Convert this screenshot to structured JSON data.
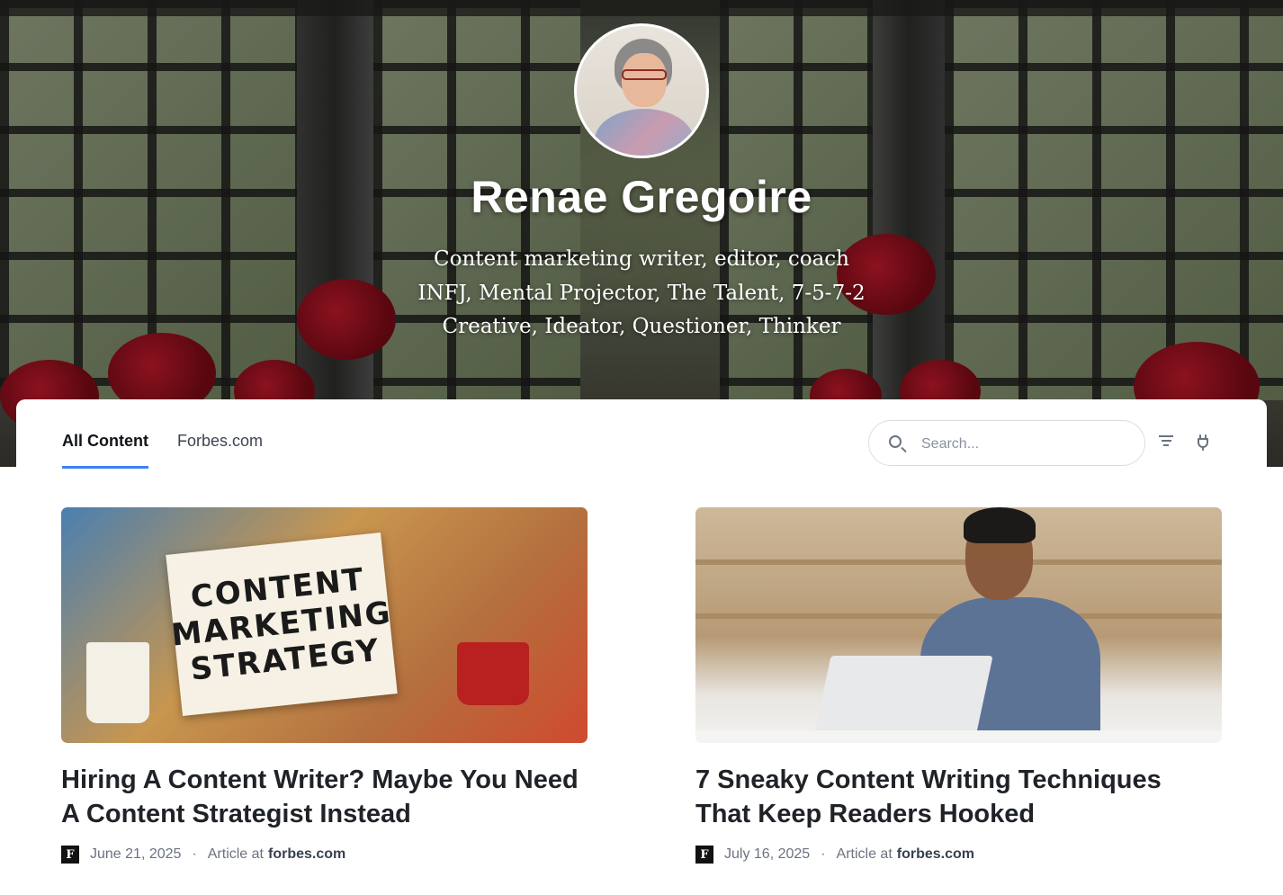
{
  "profile": {
    "name": "Renae Gregoire",
    "bio": [
      "Content marketing writer, editor, coach",
      "INFJ, Mental Projector, The Talent, 7-5-7-2",
      "Creative, Ideator, Questioner, Thinker"
    ]
  },
  "tabs": [
    {
      "label": "All Content",
      "active": true
    },
    {
      "label": "Forbes.com",
      "active": false
    }
  ],
  "search": {
    "placeholder": "Search..."
  },
  "toolbar_icons": [
    "filter-icon",
    "plug-icon"
  ],
  "articles": [
    {
      "title": "Hiring A Content Writer? Maybe You Need A Content Strategist Instead",
      "date": "June 21, 2025",
      "type": "Article at",
      "source": "forbes.com",
      "image_text": [
        "CONTENT",
        "MARKETING",
        "STRATEGY"
      ]
    },
    {
      "title": "7 Sneaky Content Writing Techniques That Keep Readers Hooked",
      "date": "July 16, 2025",
      "type": "Article at",
      "source": "forbes.com"
    }
  ],
  "colors": {
    "accent": "#3b82f6",
    "text": "#1f2328",
    "muted": "#6b7280"
  }
}
